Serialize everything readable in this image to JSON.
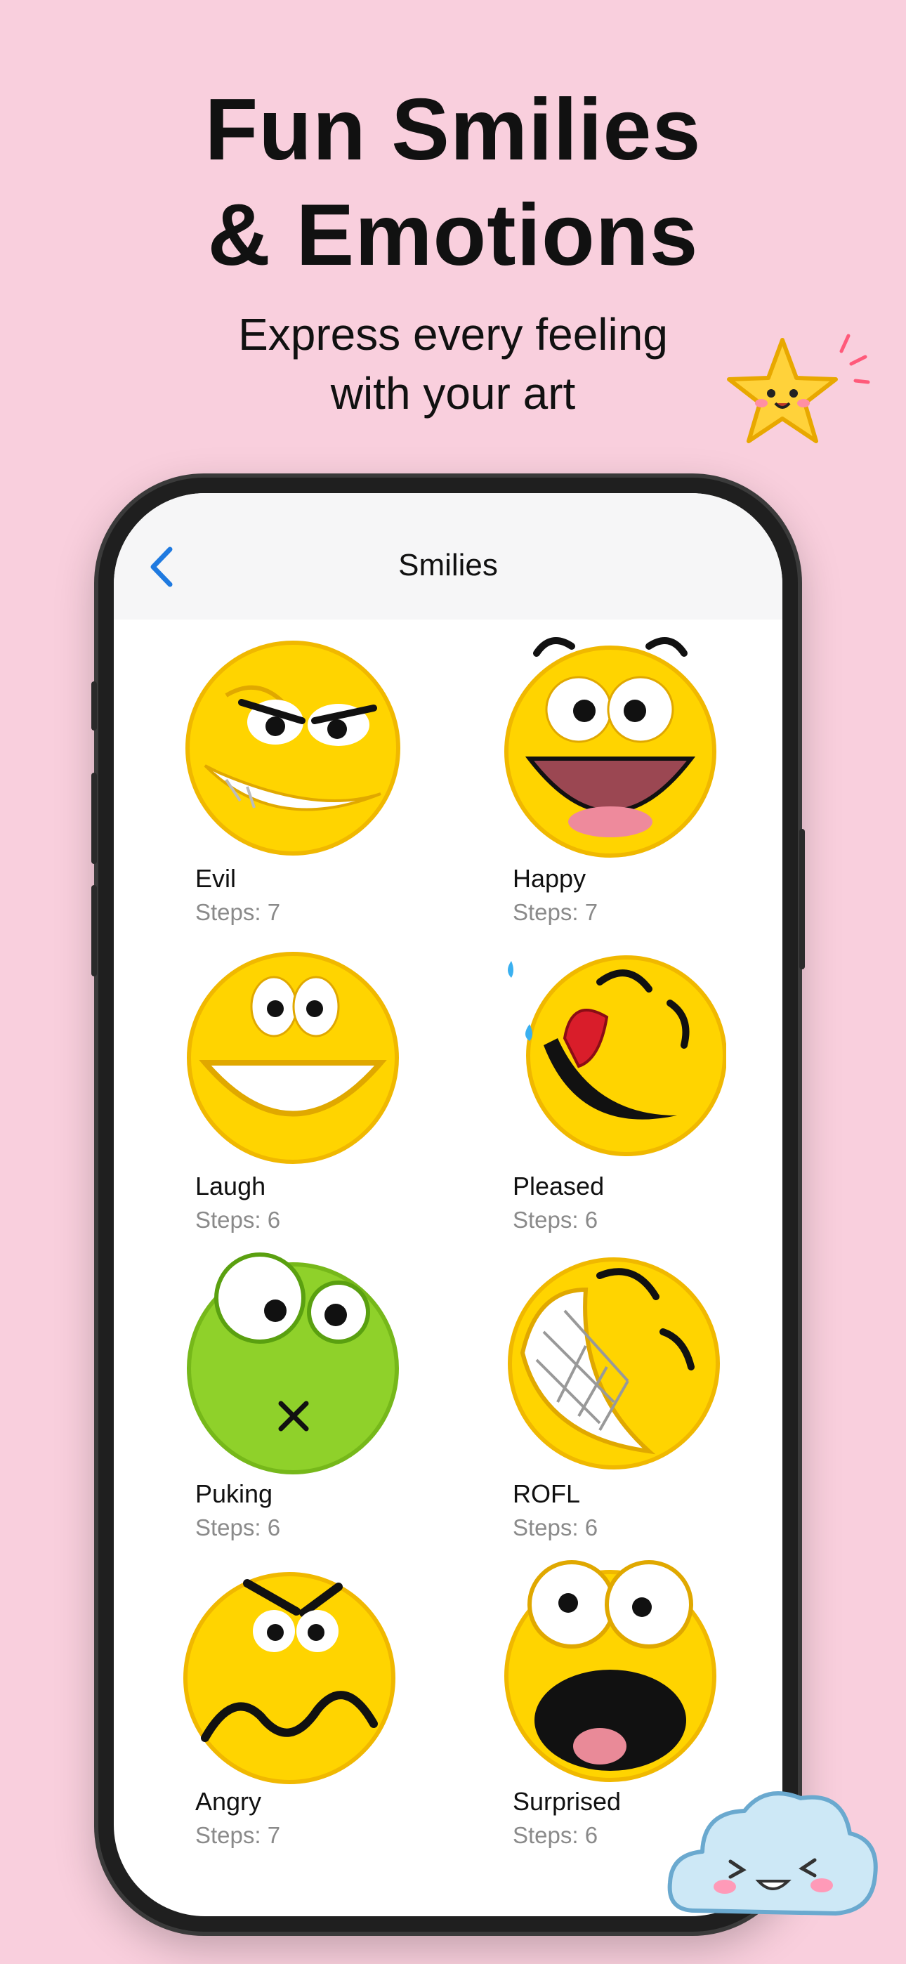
{
  "headline": {
    "line1": "Fun Smilies",
    "line2": "& Emotions"
  },
  "subhead": {
    "line1": "Express every feeling",
    "line2": "with your art"
  },
  "app": {
    "nav_title": "Smilies",
    "back_icon": "chevron-left-icon",
    "accent_color": "#1f7ae0",
    "items": [
      {
        "name": "Evil",
        "steps": "Steps: 7"
      },
      {
        "name": "Happy",
        "steps": "Steps: 7"
      },
      {
        "name": "Laugh",
        "steps": "Steps: 6"
      },
      {
        "name": "Pleased",
        "steps": "Steps: 6"
      },
      {
        "name": "Puking",
        "steps": "Steps: 6"
      },
      {
        "name": "ROFL",
        "steps": "Steps: 6"
      },
      {
        "name": "Angry",
        "steps": "Steps: 7"
      },
      {
        "name": "Surprised",
        "steps": "Steps: 6"
      }
    ]
  },
  "colors": {
    "background": "#f9cfdd",
    "smiley_yellow": "#ffd400",
    "puking_green": "#8fd12a"
  }
}
